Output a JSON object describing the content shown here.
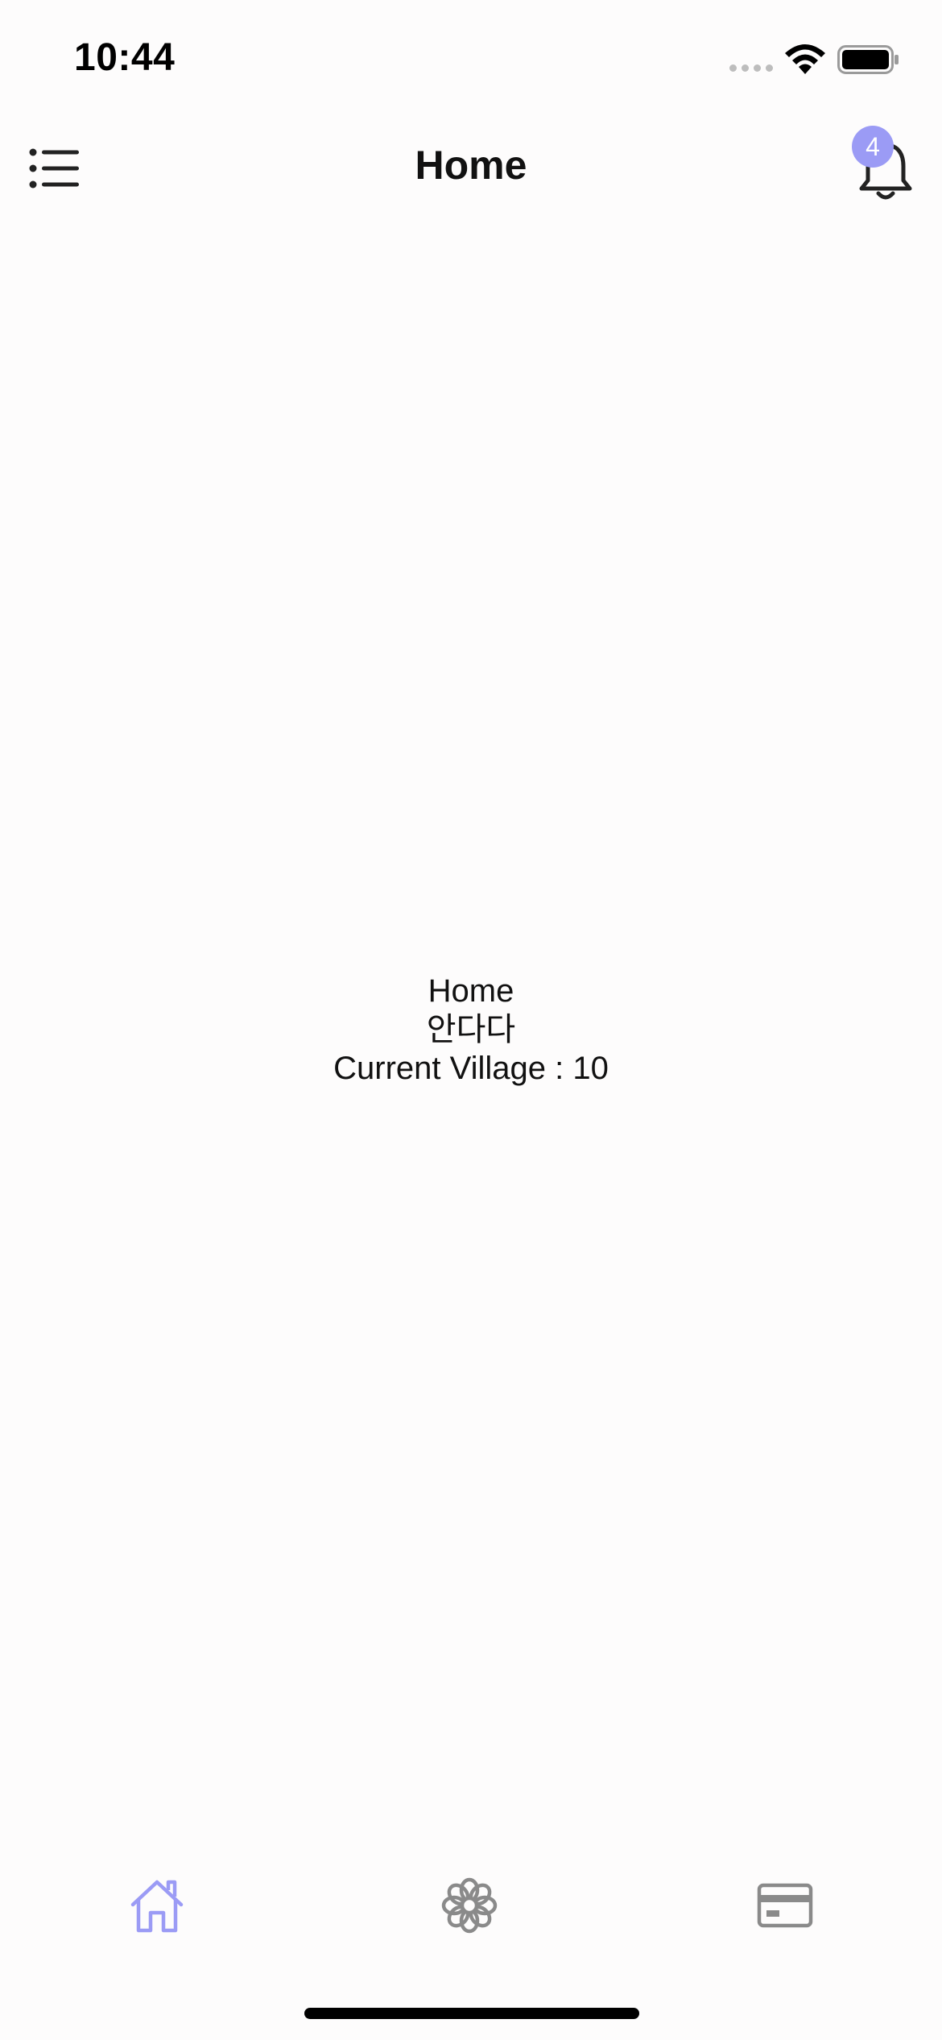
{
  "status_bar": {
    "time": "10:44"
  },
  "nav": {
    "title": "Home",
    "menu_icon": "list-icon",
    "bell_icon": "bell-icon",
    "notification_count": "4",
    "badge_color": "#9b9bf5"
  },
  "main": {
    "line1": "Home",
    "line2": "안다다",
    "line3": "Current Village : 10"
  },
  "tabs": [
    {
      "icon": "home-icon",
      "active": true,
      "color": "#9b9bf5"
    },
    {
      "icon": "flower-icon",
      "active": false,
      "color": "#8a8a8a"
    },
    {
      "icon": "card-icon",
      "active": false,
      "color": "#8a8a8a"
    }
  ]
}
